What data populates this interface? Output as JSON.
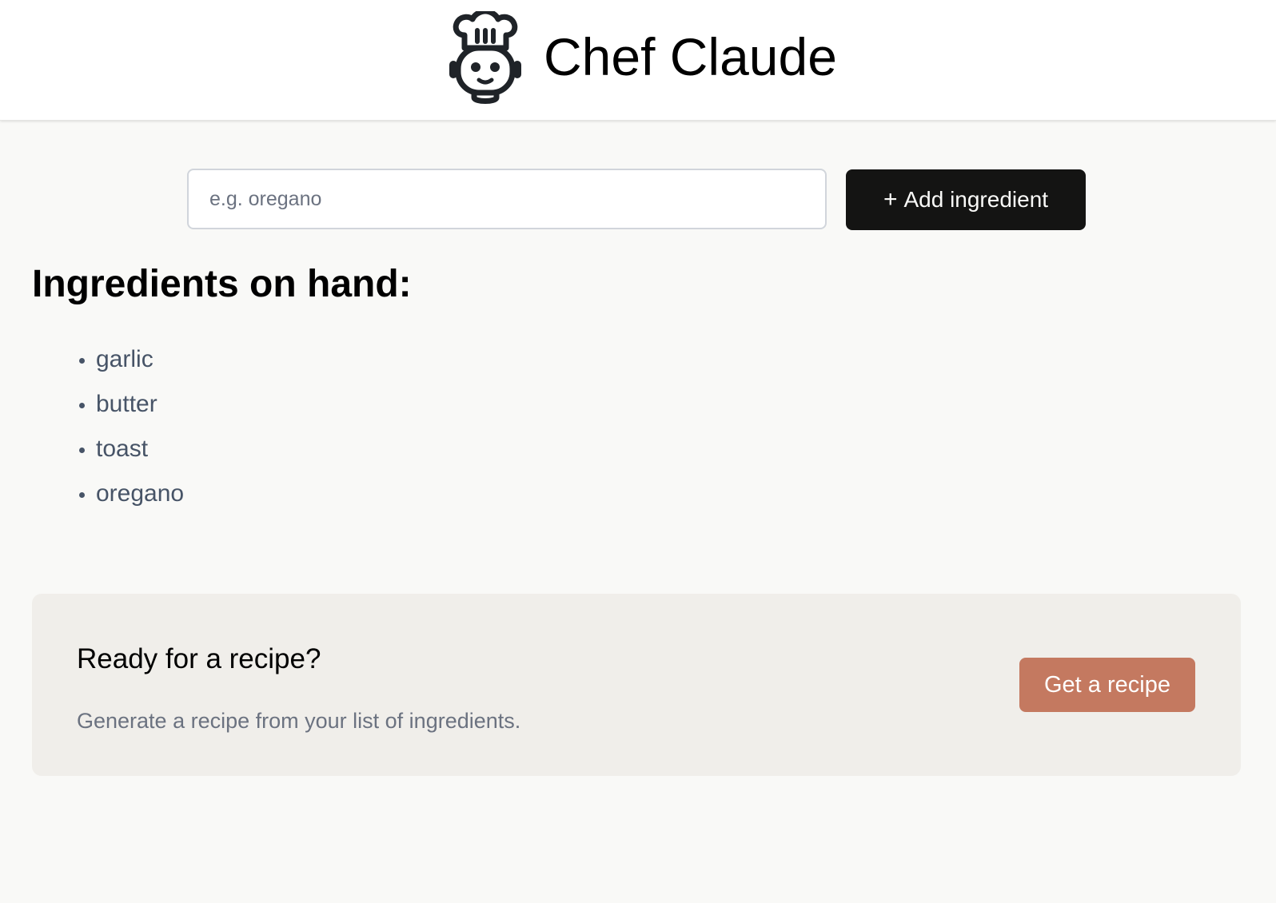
{
  "header": {
    "app_title": "Chef Claude",
    "logo_icon": "chef-robot-icon"
  },
  "add_form": {
    "input_value": "",
    "input_placeholder": "e.g. oregano",
    "add_button_icon": "+",
    "add_button_label": "Add ingredient"
  },
  "ingredients": {
    "heading": "Ingredients on hand:",
    "items": [
      "garlic",
      "butter",
      "toast",
      "oregano"
    ]
  },
  "recipe_card": {
    "title": "Ready for a recipe?",
    "subtitle": "Generate a recipe from your list of ingredients.",
    "button_label": "Get a recipe"
  },
  "colors": {
    "page_background": "#f9f9f7",
    "header_background": "#ffffff",
    "add_button_background": "#141413",
    "card_background": "#f0eeea",
    "recipe_button_background": "#c47960",
    "list_text": "#475467",
    "subtitle_text": "#6b7280"
  }
}
